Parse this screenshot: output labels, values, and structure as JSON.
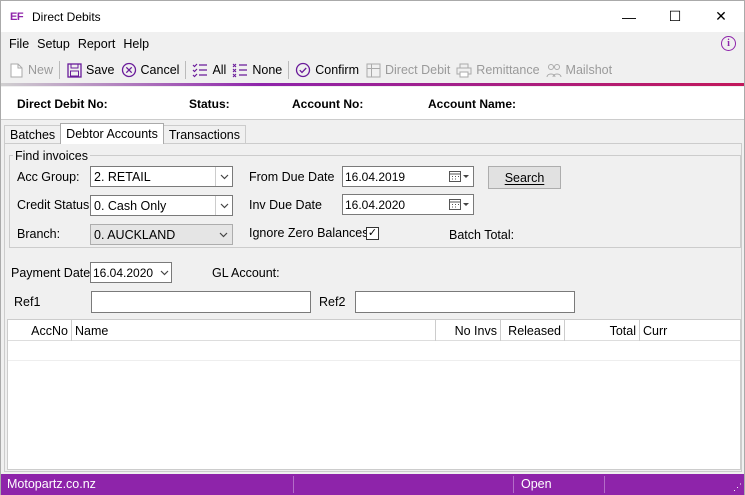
{
  "window": {
    "logo": "EF",
    "title": "Direct Debits",
    "minimize": "—",
    "maximize": "☐",
    "close": "✕"
  },
  "menu": {
    "items": [
      {
        "label": "File",
        "key": "F"
      },
      {
        "label": "Setup",
        "key": "S"
      },
      {
        "label": "Report",
        "key": "R"
      },
      {
        "label": "Help",
        "key": "H"
      }
    ],
    "info": "i"
  },
  "toolbar": {
    "new": "New",
    "save": "Save",
    "cancel": "Cancel",
    "all": "All",
    "none": "None",
    "confirm": "Confirm",
    "direct_debit": "Direct Debit",
    "remittance": "Remittance",
    "mailshot": "Mailshot"
  },
  "header": {
    "direct_debit_no": "Direct Debit No:",
    "status": "Status:",
    "account_no": "Account No:",
    "account_name": "Account Name:"
  },
  "tabs": [
    {
      "label": "Batches",
      "active": false
    },
    {
      "label": "Debtor Accounts",
      "active": true
    },
    {
      "label": "Transactions",
      "active": false
    }
  ],
  "find": {
    "group_title": "Find invoices",
    "acc_group_label": "Acc Group:",
    "acc_group_value": "2. RETAIL",
    "credit_status_label": "Credit Status",
    "credit_status_value": "0. Cash Only",
    "branch_label": "Branch:",
    "branch_value": "0. AUCKLAND",
    "from_due_date_label": "From Due Date",
    "from_due_date_value": "16.04.2019",
    "inv_due_date_label": "Inv Due Date",
    "inv_due_date_value": "16.04.2020",
    "ignore_zero_label": "Ignore Zero Balances",
    "ignore_zero_checked": "✓",
    "search_button": "Search",
    "batch_total_label": "Batch Total:"
  },
  "payment": {
    "payment_date_label": "Payment Date",
    "payment_date_value": "16.04.2020",
    "gl_account_label": "GL Account:",
    "ref1_label": "Ref1",
    "ref2_label": "Ref2"
  },
  "grid": {
    "columns": [
      "AccNo",
      "Name",
      "No Invs",
      "Released",
      "Total",
      "Curr"
    ]
  },
  "statusbar": {
    "company": "Motopartz.co.nz",
    "state": "Open"
  },
  "colors": {
    "accent": "#8e24aa"
  }
}
